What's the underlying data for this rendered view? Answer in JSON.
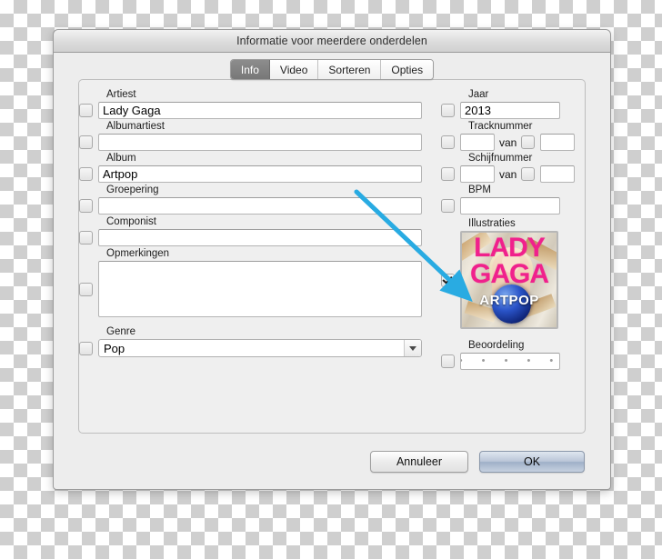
{
  "window": {
    "title": "Informatie voor meerdere onderdelen"
  },
  "tabs": [
    {
      "label": "Info",
      "active": true
    },
    {
      "label": "Video",
      "active": false
    },
    {
      "label": "Sorteren",
      "active": false
    },
    {
      "label": "Opties",
      "active": false
    }
  ],
  "left_fields": {
    "artiest": {
      "label": "Artiest",
      "value": "Lady Gaga",
      "checked": false
    },
    "albumartiest": {
      "label": "Albumartiest",
      "value": "",
      "checked": false
    },
    "album": {
      "label": "Album",
      "value": "Artpop",
      "checked": false
    },
    "groepering": {
      "label": "Groepering",
      "value": "",
      "checked": false
    },
    "componist": {
      "label": "Componist",
      "value": "",
      "checked": false
    },
    "opmerkingen": {
      "label": "Opmerkingen",
      "value": "",
      "checked": false
    },
    "genre": {
      "label": "Genre",
      "value": "Pop",
      "checked": false
    }
  },
  "right_fields": {
    "jaar": {
      "label": "Jaar",
      "value": "2013",
      "checked": false
    },
    "tracknummer": {
      "label": "Tracknummer",
      "value": "",
      "total": "",
      "van": "van",
      "checked": false,
      "total_checked": false
    },
    "schijfnummer": {
      "label": "Schijfnummer",
      "value": "",
      "total": "",
      "van": "van",
      "checked": false,
      "total_checked": false
    },
    "bpm": {
      "label": "BPM",
      "value": "",
      "checked": false
    },
    "illustraties": {
      "label": "Illustraties",
      "checked": true
    },
    "beoordeling": {
      "label": "Beoordeling",
      "value": "• • • • •",
      "checked": false
    }
  },
  "artwork": {
    "artist_line1": "LADY",
    "artist_line2": "GAGA",
    "album_title": "ARTPOP"
  },
  "buttons": {
    "cancel": "Annuleer",
    "ok": "OK"
  },
  "colors": {
    "accent_arrow": "#29ABE2",
    "artwork_pink": "#F0218C",
    "tab_active_bg": "#7F7F7F",
    "window_bg": "#EDEDED"
  }
}
